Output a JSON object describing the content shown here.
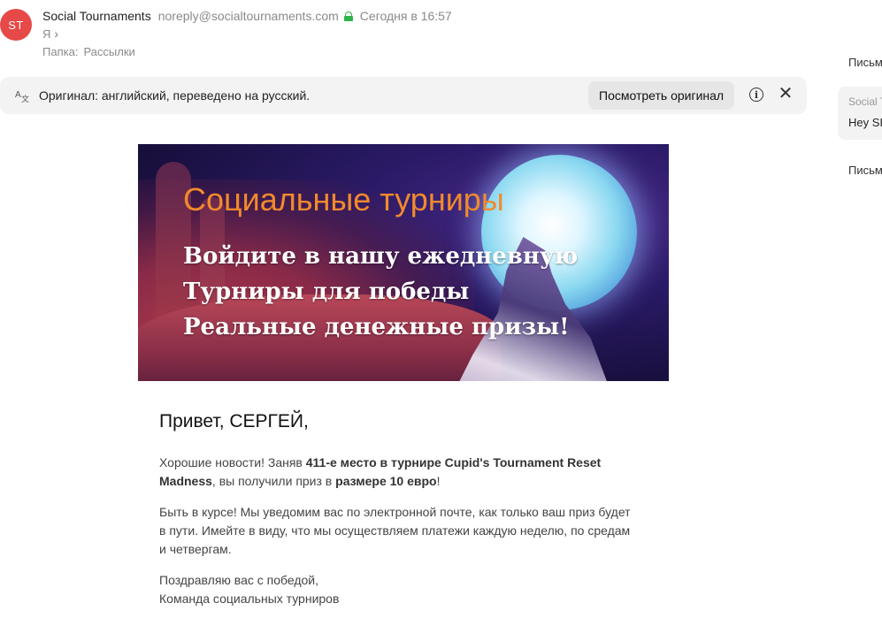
{
  "sender": {
    "avatar_initials": "ST",
    "avatar_color": "#e74848",
    "name": "Social Tournaments",
    "email": "noreply@socialtournaments.com",
    "date": "Сегодня в 16:57",
    "recipient": "Я",
    "folder_label": "Папка:",
    "folder_value": "Рассылки"
  },
  "translation_bar": {
    "icon": "translate-icon",
    "text": "Оригинал: английский, переведено на русский.",
    "view_original_label": "Посмотреть оригинал",
    "info_icon": "info-icon",
    "close_icon": "close-icon"
  },
  "right_column": {
    "label_top": "Письм",
    "card_sender": "Social T",
    "card_snippet": "Hey SI",
    "label_bottom": "Письм"
  },
  "banner": {
    "title": "Социальные турниры",
    "line1": "Войдите в нашу ежедневную",
    "line2": "Турниры для победы",
    "line3": "Реальные денежные призы!",
    "title_color": "#f28a2c"
  },
  "body": {
    "greeting": "Привет, СЕРГЕЙ,",
    "p1_a": "Хорошие новости! Заняв ",
    "p1_b": "411-е место в турнире Cupid's Tournament Reset Madness",
    "p1_c": ", вы получили приз в ",
    "p1_d": "размере 10 евро",
    "p1_e": "!",
    "p2": "Быть в курсе! Мы уведомим вас по электронной почте, как только ваш приз будет в пути. Имейте в виду, что мы осуществляем платежи каждую неделю, по средам и четвергам.",
    "p3_line1": "Поздравляю вас с победой,",
    "p3_line2": "Команда социальных турниров"
  }
}
